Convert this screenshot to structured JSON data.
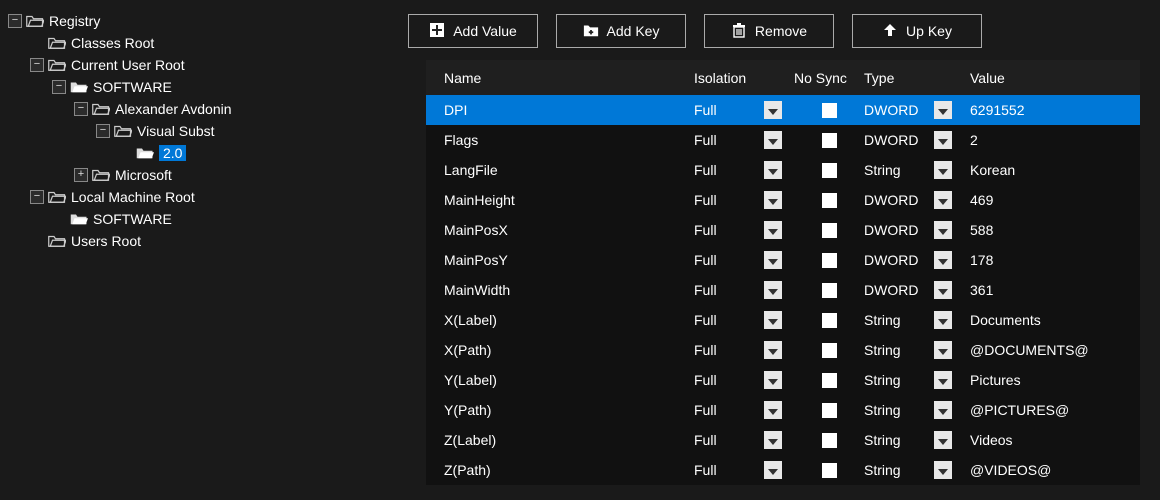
{
  "toolbar": {
    "add_value": "Add Value",
    "add_key": "Add Key",
    "remove": "Remove",
    "up_key": "Up Key"
  },
  "headers": {
    "name": "Name",
    "isolation": "Isolation",
    "nosync": "No Sync",
    "type": "Type",
    "value": "Value"
  },
  "tree": {
    "registry": "Registry",
    "classes_root": "Classes Root",
    "current_user_root": "Current User Root",
    "software1": "SOFTWARE",
    "alexander": "Alexander Avdonin",
    "visual_subst": "Visual Subst",
    "v20": "2.0",
    "microsoft": "Microsoft",
    "local_machine_root": "Local Machine Root",
    "software2": "SOFTWARE",
    "users_root": "Users Root",
    "exp_minus": "−",
    "exp_plus": "+"
  },
  "rows": [
    {
      "name": "DPI",
      "isolation": "Full",
      "type": "DWORD",
      "value": "6291552",
      "selected": true
    },
    {
      "name": "Flags",
      "isolation": "Full",
      "type": "DWORD",
      "value": "2",
      "selected": false
    },
    {
      "name": "LangFile",
      "isolation": "Full",
      "type": "String",
      "value": "Korean",
      "selected": false
    },
    {
      "name": "MainHeight",
      "isolation": "Full",
      "type": "DWORD",
      "value": "469",
      "selected": false
    },
    {
      "name": "MainPosX",
      "isolation": "Full",
      "type": "DWORD",
      "value": "588",
      "selected": false
    },
    {
      "name": "MainPosY",
      "isolation": "Full",
      "type": "DWORD",
      "value": "178",
      "selected": false
    },
    {
      "name": "MainWidth",
      "isolation": "Full",
      "type": "DWORD",
      "value": "361",
      "selected": false
    },
    {
      "name": "X(Label)",
      "isolation": "Full",
      "type": "String",
      "value": "Documents",
      "selected": false
    },
    {
      "name": "X(Path)",
      "isolation": "Full",
      "type": "String",
      "value": "@DOCUMENTS@",
      "selected": false
    },
    {
      "name": "Y(Label)",
      "isolation": "Full",
      "type": "String",
      "value": "Pictures",
      "selected": false
    },
    {
      "name": "Y(Path)",
      "isolation": "Full",
      "type": "String",
      "value": "@PICTURES@",
      "selected": false
    },
    {
      "name": "Z(Label)",
      "isolation": "Full",
      "type": "String",
      "value": "Videos",
      "selected": false
    },
    {
      "name": "Z(Path)",
      "isolation": "Full",
      "type": "String",
      "value": "@VIDEOS@",
      "selected": false
    }
  ]
}
